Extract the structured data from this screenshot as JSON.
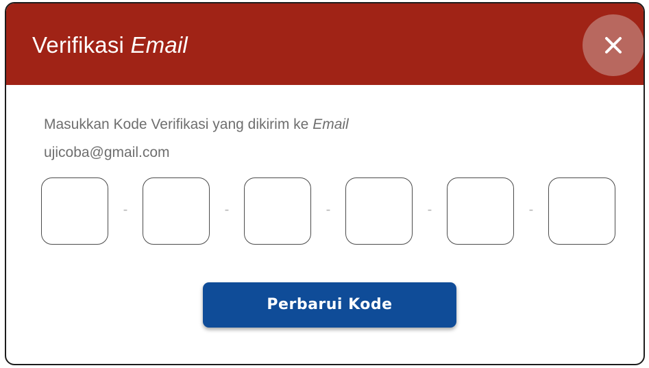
{
  "dialog": {
    "title_prefix": "Verifikasi",
    "title_italic": "Email",
    "close_icon": "close-icon"
  },
  "message": {
    "line1_prefix": "Masukkan Kode Verifikasi yang dikirim ke",
    "line1_italic": "Email",
    "email": "ujicoba@gmail.com"
  },
  "otp": {
    "digits": [
      "",
      "",
      "",
      "",
      "",
      ""
    ],
    "separator": "-"
  },
  "actions": {
    "refresh_label": "Perbarui Kode"
  },
  "colors": {
    "header": "#a02316",
    "close_button": "#b8685f",
    "primary_button": "#0f4c98"
  }
}
